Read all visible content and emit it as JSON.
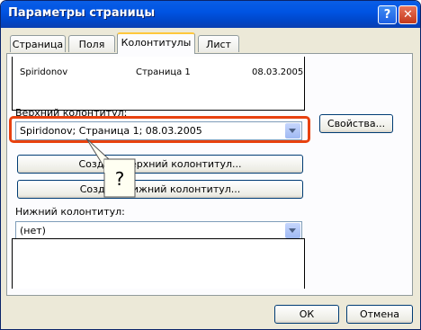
{
  "window": {
    "title": "Параметры страницы",
    "help_label": "?",
    "close_label": "✕"
  },
  "tabs": [
    {
      "label": "Страница",
      "active": false
    },
    {
      "label": "Поля",
      "active": false
    },
    {
      "label": "Колонтитулы",
      "active": true
    },
    {
      "label": "Лист",
      "active": false
    }
  ],
  "preview": {
    "left": "Spiridonov",
    "center": "Страница 1",
    "right": "08.03.2005"
  },
  "header": {
    "label": "Верхний колонтитул:",
    "value": "Spiridonov; Страница 1; 08.03.2005",
    "properties_button": "Свойства..."
  },
  "create_header_button": "Создать верхний колонтитул...",
  "create_footer_button": "Создать нижний колонтитул...",
  "footer": {
    "label": "Нижний колонтитул:",
    "value": "(нет)"
  },
  "callout": {
    "text": "?"
  },
  "buttons": {
    "ok": "ОК",
    "cancel": "Отмена"
  },
  "colors": {
    "titlebar": "#0054e3",
    "highlight": "#e8410f",
    "dialog": "#ece9d8"
  }
}
